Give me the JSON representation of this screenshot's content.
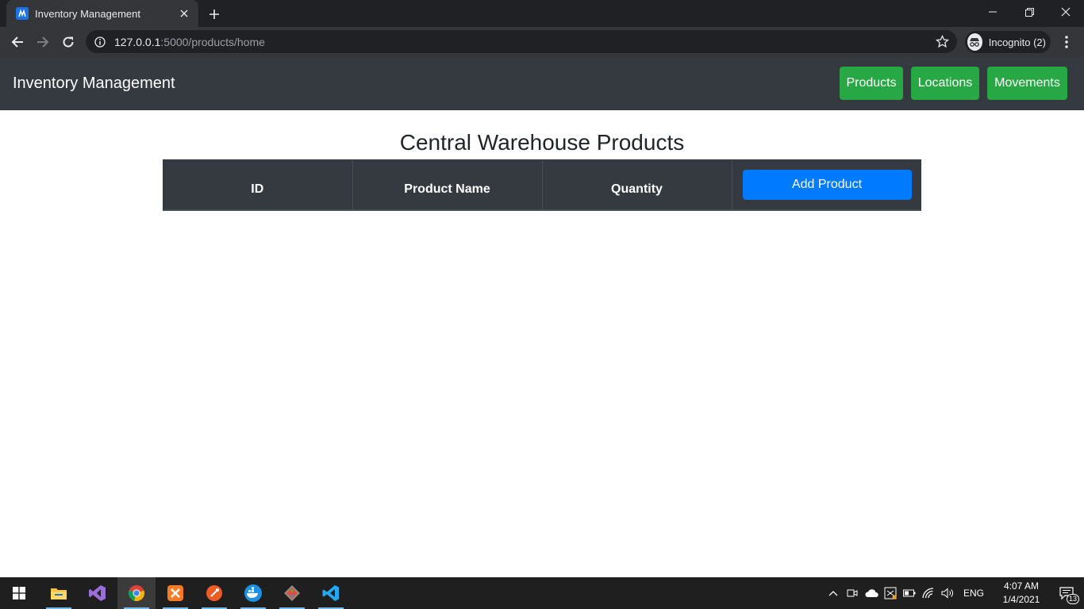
{
  "browser": {
    "tab_title": "Inventory Management",
    "url_host": "127.0.0.1",
    "url_rest": ":5000/products/home",
    "profile_label": "Incognito (2)"
  },
  "navbar": {
    "brand": "Inventory Management",
    "links": [
      {
        "label": "Products"
      },
      {
        "label": "Locations"
      },
      {
        "label": "Movements"
      }
    ]
  },
  "main": {
    "title": "Central Warehouse Products",
    "table": {
      "columns": [
        "ID",
        "Product Name",
        "Quantity"
      ],
      "add_button_label": "Add Product",
      "rows": []
    }
  },
  "taskbar": {
    "apps": [
      "start-icon",
      "file-explorer-icon",
      "visual-studio-icon",
      "chrome-icon",
      "xampp-icon",
      "postman-icon",
      "docker-icon",
      "git-icon",
      "vscode-icon"
    ],
    "language": "ENG",
    "time": "4:07 AM",
    "date": "1/4/2021",
    "notification_count": "13"
  },
  "colors": {
    "navbar_bg": "#343a40",
    "nav_link_green": "#28a745",
    "add_button_blue": "#007bff",
    "table_head_bg": "#343a40"
  }
}
